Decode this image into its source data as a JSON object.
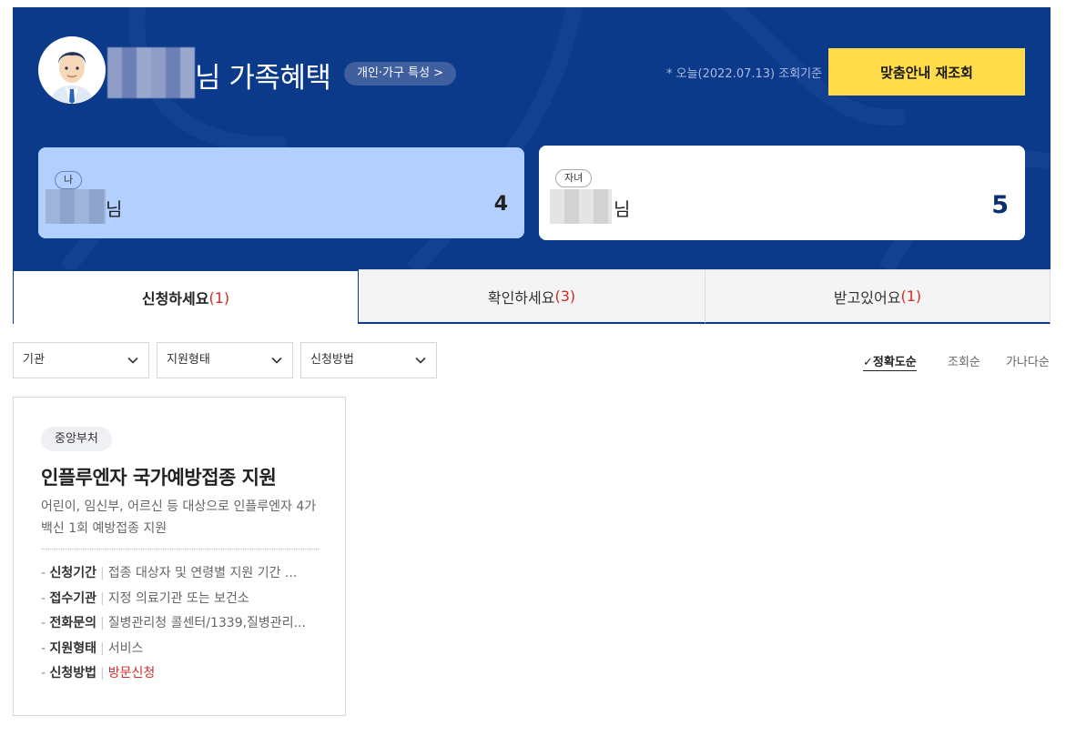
{
  "header": {
    "title_suffix": "님 가족혜택",
    "trait_button": "개인·가구 특성 >",
    "date_note": "* 오늘(2022.07.13) 조회기준",
    "requery_button": "맞춤안내 재조회"
  },
  "members": [
    {
      "tag": "나",
      "honorific": "님",
      "count": "4"
    },
    {
      "tag": "자녀",
      "honorific": "님",
      "count": "5"
    }
  ],
  "tabs": [
    {
      "label": "신청하세요",
      "count": "(1)"
    },
    {
      "label": "확인하세요",
      "count": "(3)"
    },
    {
      "label": "받고있어요",
      "count": "(1)"
    }
  ],
  "filters": [
    "기관",
    "지원형태",
    "신청방법"
  ],
  "sort": {
    "options": [
      "정확도순",
      "조회순",
      "가나다순"
    ],
    "active_mark": "✓"
  },
  "card": {
    "agency": "중앙부처",
    "title": "인플루엔자 국가예방접종 지원",
    "description": "어린이, 임신부, 어르신 등 대상으로 인플루엔자 4가백신 1회 예방접종 지원",
    "rows": [
      {
        "label": "신청기간",
        "value": "접종 대상자 및 연령별 지원 기간 ..."
      },
      {
        "label": "접수기관",
        "value": "지정 의료기관 또는 보건소"
      },
      {
        "label": "전화문의",
        "value": "질병관리청 콜센터/1339,질병관리..."
      },
      {
        "label": "지원형태",
        "value": "서비스"
      },
      {
        "label": "신청방법",
        "value": "방문신청"
      }
    ]
  },
  "colors": {
    "hero_bg": "#0b3a8a",
    "requery_bg": "#ffdd4a",
    "me_card_bg": "#b2cffd",
    "count_red": "#d42a2a"
  }
}
